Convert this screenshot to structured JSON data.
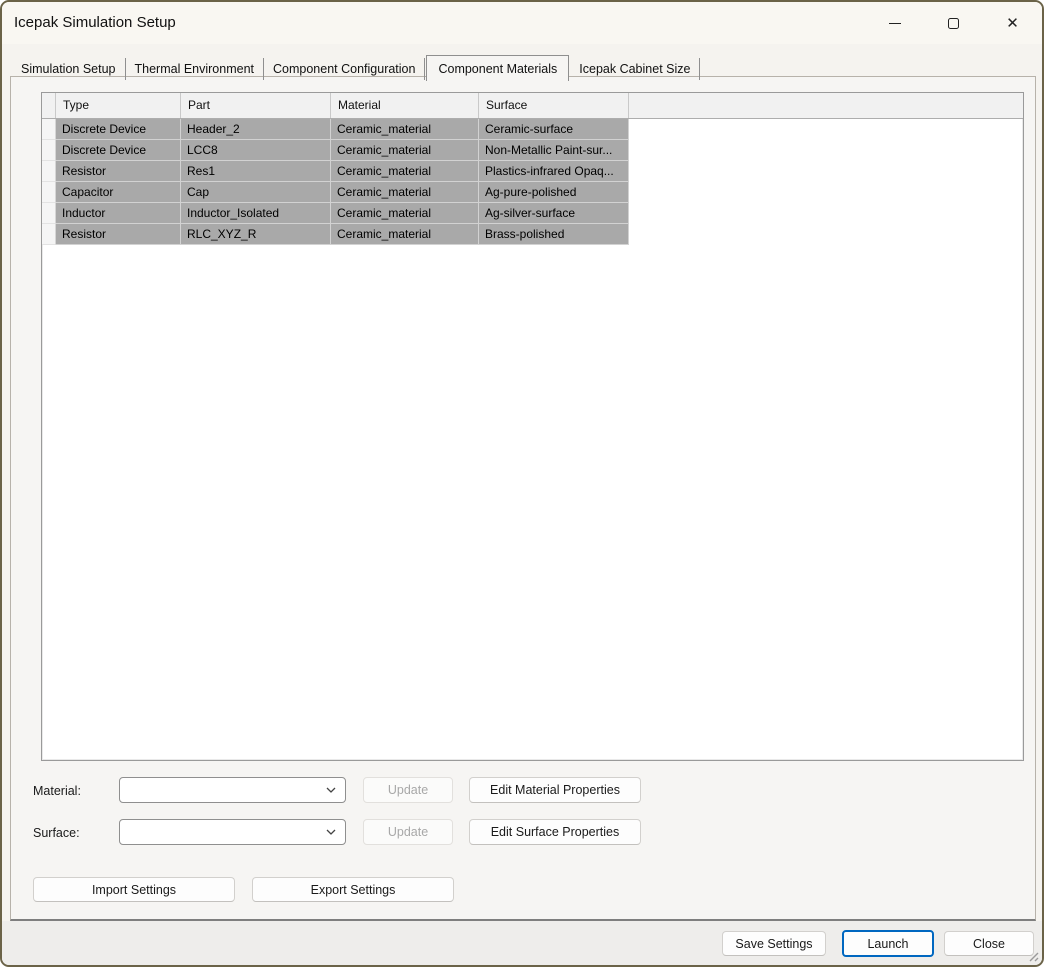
{
  "window": {
    "title": "Icepak Simulation Setup"
  },
  "icons": {
    "minimize": "thin-horizontal-line",
    "maximize": "outlined-square",
    "close": "x-cross",
    "close_glyph": "✕",
    "combo_chevron": "chevron-down",
    "resize_grip": "diagonal-lines"
  },
  "tabs": [
    {
      "id": "simulation-setup",
      "label": "Simulation Setup",
      "active": false
    },
    {
      "id": "thermal-environment",
      "label": "Thermal Environment",
      "active": false
    },
    {
      "id": "component-configuration",
      "label": "Component Configuration",
      "active": false
    },
    {
      "id": "component-materials",
      "label": "Component Materials",
      "active": true
    },
    {
      "id": "icepak-cabinet-size",
      "label": "Icepak Cabinet Size",
      "active": false
    }
  ],
  "table": {
    "columns": [
      "Type",
      "Part",
      "Material",
      "Surface"
    ],
    "rows": [
      [
        "Discrete Device",
        "Header_2",
        "Ceramic_material",
        "Ceramic-surface"
      ],
      [
        "Discrete Device",
        "LCC8",
        "Ceramic_material",
        "Non-Metallic Paint-sur..."
      ],
      [
        "Resistor",
        "Res1",
        "Ceramic_material",
        "Plastics-infrared Opaq..."
      ],
      [
        "Capacitor",
        "Cap",
        "Ceramic_material",
        "Ag-pure-polished"
      ],
      [
        "Inductor",
        "Inductor_Isolated",
        "Ceramic_material",
        "Ag-silver-surface"
      ],
      [
        "Resistor",
        "RLC_XYZ_R",
        "Ceramic_material",
        "Brass-polished"
      ]
    ]
  },
  "material_row": {
    "label": "Material:",
    "combo_value": "",
    "update_label": "Update",
    "update_enabled": false,
    "edit_label": "Edit Material Properties"
  },
  "surface_row": {
    "label": "Surface:",
    "combo_value": "",
    "update_label": "Update",
    "update_enabled": false,
    "edit_label": "Edit Surface Properties"
  },
  "settings_buttons": {
    "import": "Import Settings",
    "export": "Export Settings"
  },
  "footer": {
    "save": "Save Settings",
    "launch": "Launch",
    "close": "Close"
  },
  "colors": {
    "dialog_border": "#6B6348",
    "titlebar_bg": "#F9F7F2",
    "page_bg": "#F6F5F3",
    "grid_header_bg": "#F1F1F1",
    "row_selected_gray": "#A9A9A9",
    "accent_blue": "#0067C0"
  }
}
